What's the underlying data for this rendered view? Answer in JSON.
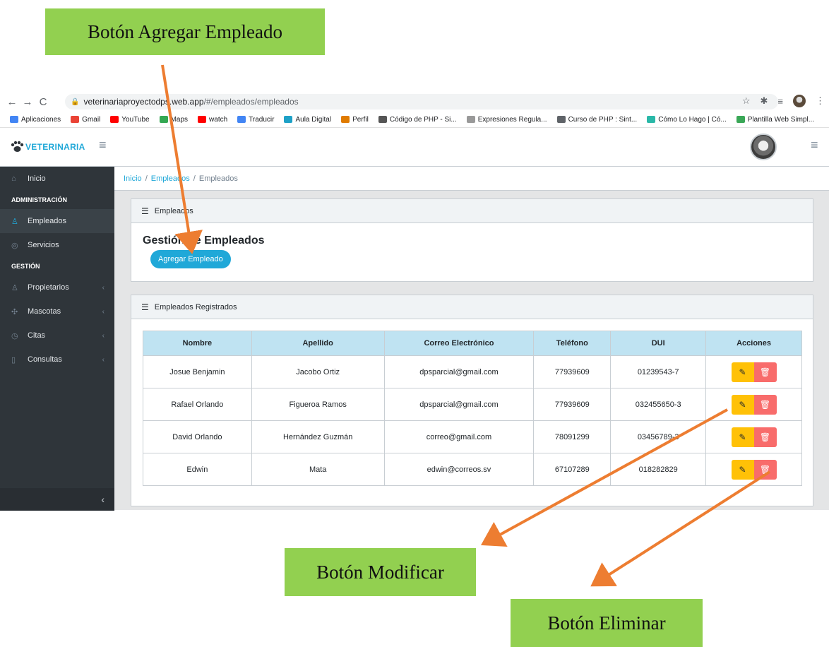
{
  "callouts": {
    "add": "Botón Agregar Empleado",
    "edit": "Botón Modificar",
    "delete": "Botón Eliminar"
  },
  "browser": {
    "url_host": "veterinariaproyectodps.web.app",
    "url_path": "/#/empleados/empleados",
    "bookmarks": [
      "Aplicaciones",
      "Gmail",
      "YouTube",
      "Maps",
      "watch",
      "Traducir",
      "Aula Digital",
      "Perfil",
      "Código de PHP - Si...",
      "Expresiones Regula...",
      "Curso de PHP : Sint...",
      "Cómo Lo Hago | Có...",
      "Plantilla Web Simpl..."
    ]
  },
  "app": {
    "brand": "VETERINARIA",
    "sidebar": {
      "inicio": "Inicio",
      "section_admin": "ADMINISTRACIÓN",
      "empleados": "Empleados",
      "servicios": "Servicios",
      "section_gestion": "GESTIÓN",
      "propietarios": "Propietarios",
      "mascotas": "Mascotas",
      "citas": "Citas",
      "consultas": "Consultas"
    },
    "breadcrumb": [
      "Inicio",
      "Empleados",
      "Empleados"
    ],
    "card1": {
      "header": "Empleados",
      "title": "Gestión de Empleados",
      "add_button": "Agregar Empleado"
    },
    "card2": {
      "header": "Empleados Registrados",
      "columns": [
        "Nombre",
        "Apellido",
        "Correo Electrónico",
        "Teléfono",
        "DUI",
        "Acciones"
      ],
      "rows": [
        [
          "Josue Benjamin",
          "Jacobo Ortiz",
          "dpsparcial@gmail.com",
          "77939609",
          "01239543-7"
        ],
        [
          "Rafael Orlando",
          "Figueroa Ramos",
          "dpsparcial@gmail.com",
          "77939609",
          "032455650-3"
        ],
        [
          "David Orlando",
          "Hernández Guzmán",
          "correo@gmail.com",
          "78091299",
          "03456789-3"
        ],
        [
          "Edwin",
          "Mata",
          "edwin@correos.sv",
          "67107289",
          "018282829"
        ]
      ]
    }
  },
  "colors": {
    "accent": "#20a8d8",
    "sidebar_bg": "#2f353a",
    "edit": "#ffc107",
    "delete": "#f86c6b",
    "callout": "#92d050",
    "arrow": "#ed7d31"
  },
  "icons": {
    "sidebar_inicio": "home-icon",
    "sidebar_empleados": "users-icon",
    "sidebar_servicios": "check-circle-icon",
    "sidebar_propietarios": "user-icon",
    "sidebar_mascotas": "paw-icon",
    "sidebar_citas": "clock-icon",
    "sidebar_consultas": "file-icon",
    "edit": "pencil-icon",
    "delete": "trash-icon"
  }
}
